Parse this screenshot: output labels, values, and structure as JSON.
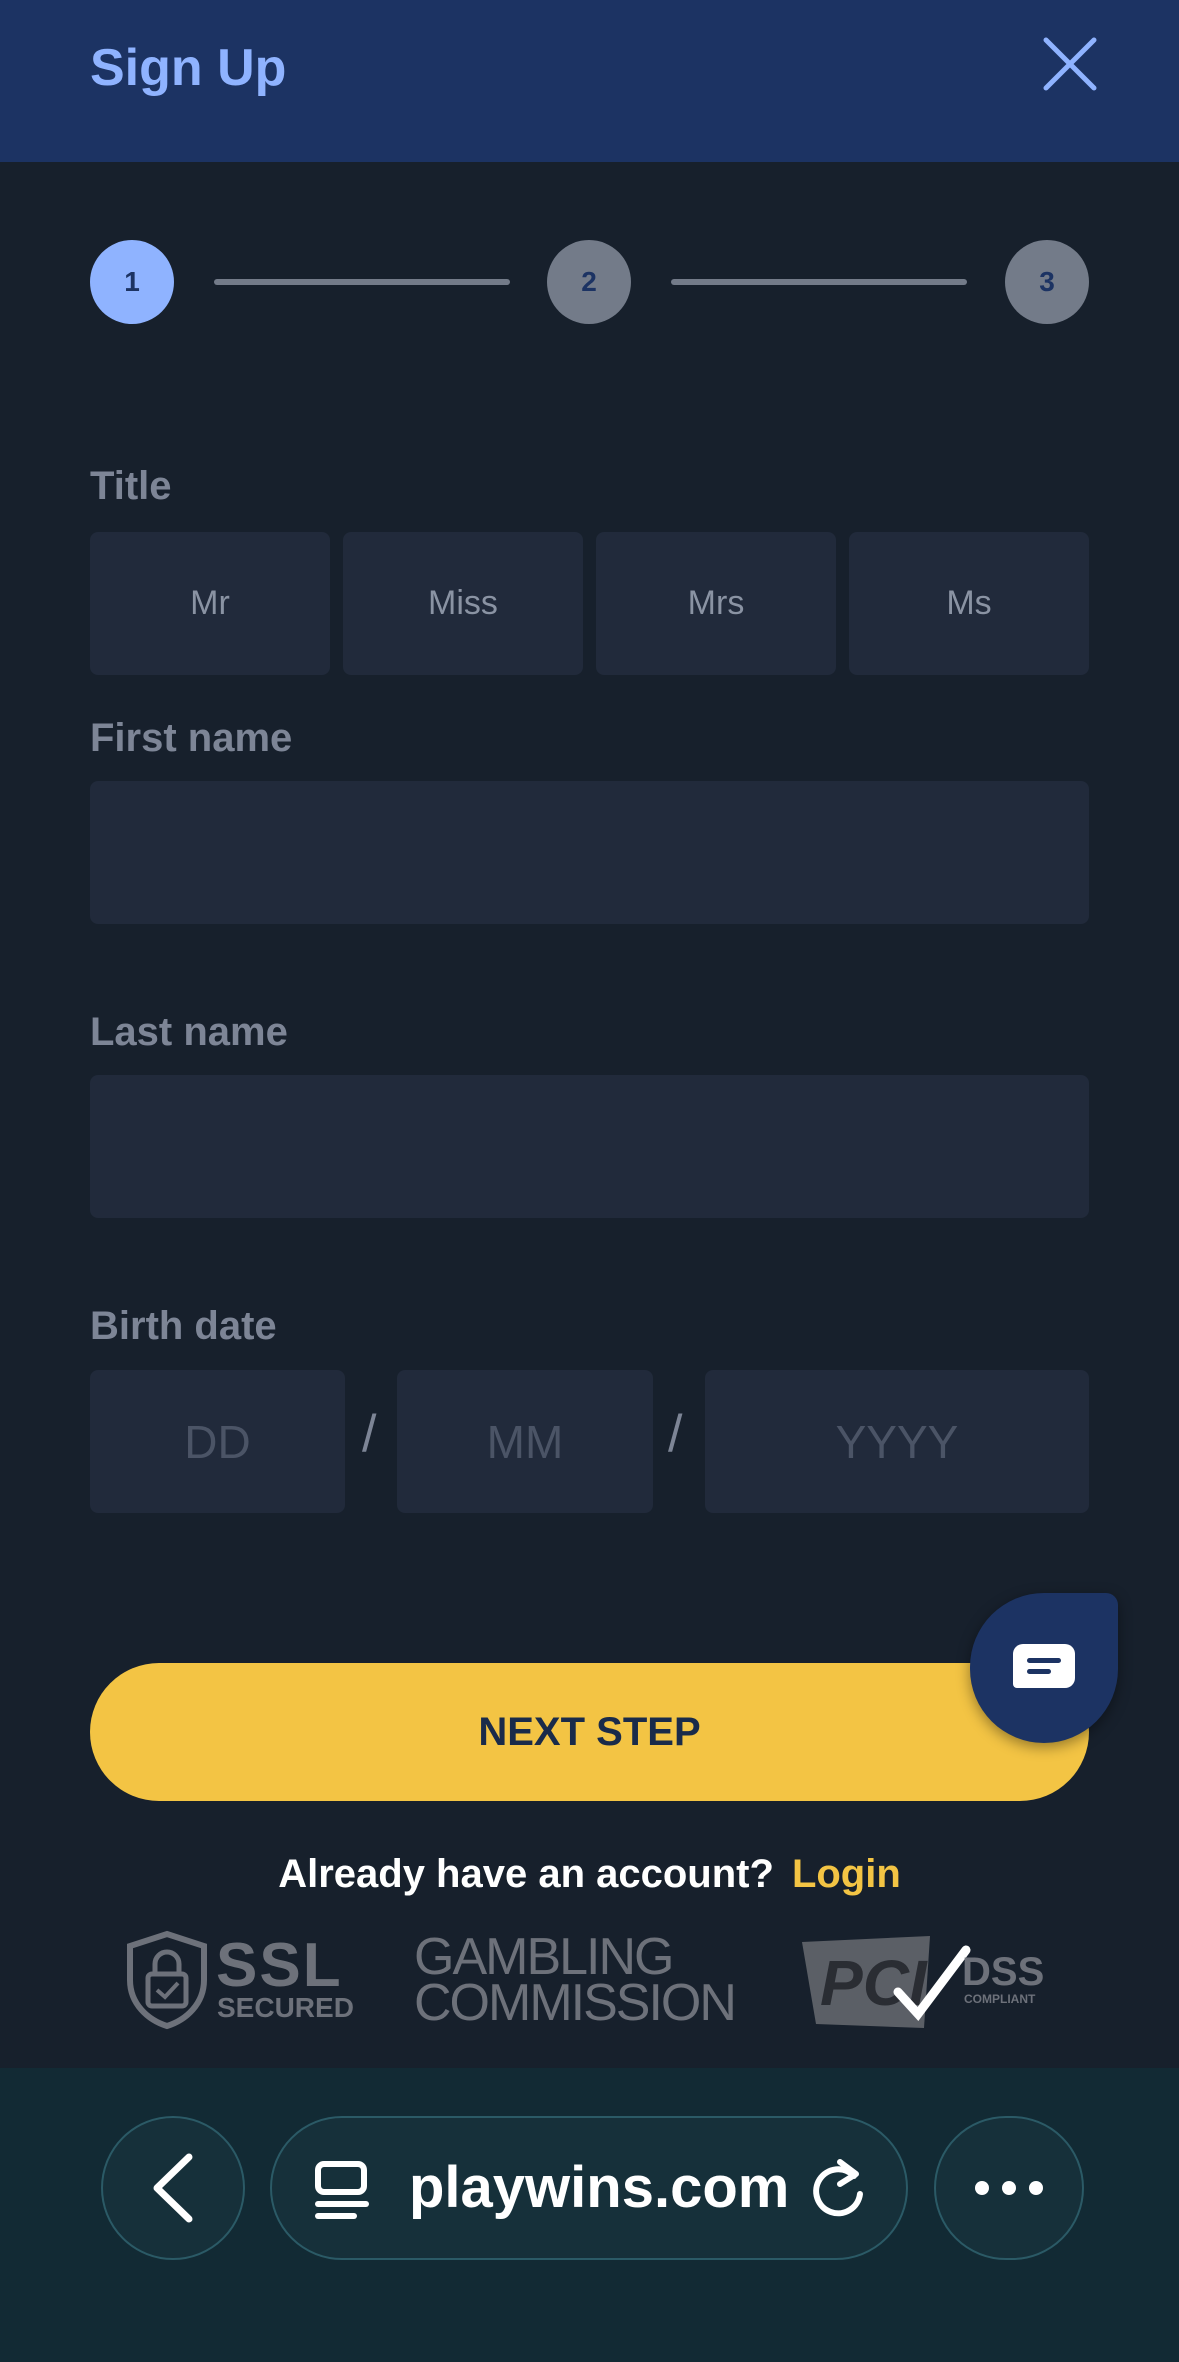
{
  "header": {
    "title": "Sign Up"
  },
  "stepper": {
    "steps": [
      "1",
      "2",
      "3"
    ],
    "active_step": 1
  },
  "form": {
    "title_label": "Title",
    "title_options": [
      "Mr",
      "Miss",
      "Mrs",
      "Ms"
    ],
    "first_name_label": "First name",
    "first_name_value": "",
    "last_name_label": "Last name",
    "last_name_value": "",
    "birth_date_label": "Birth date",
    "birth_day_placeholder": "DD",
    "birth_month_placeholder": "MM",
    "birth_year_placeholder": "YYYY",
    "date_separator": "/"
  },
  "actions": {
    "next_step_label": "NEXT STEP",
    "account_prompt": "Already have an account?",
    "login_label": "Login"
  },
  "badges": {
    "ssl_main": "SSL",
    "ssl_sub": "SECURED",
    "gambling_line1": "GAMBLING",
    "gambling_line2": "COMMISSION",
    "pci_main": "PCI",
    "pci_dss": "DSS",
    "pci_sub": "COMPLIANT"
  },
  "browser": {
    "url": "playwins.com"
  },
  "colors": {
    "accent": "#8fb3ff",
    "header_bg": "#1c3363",
    "primary_button": "#f3c444",
    "background": "#17202c"
  }
}
